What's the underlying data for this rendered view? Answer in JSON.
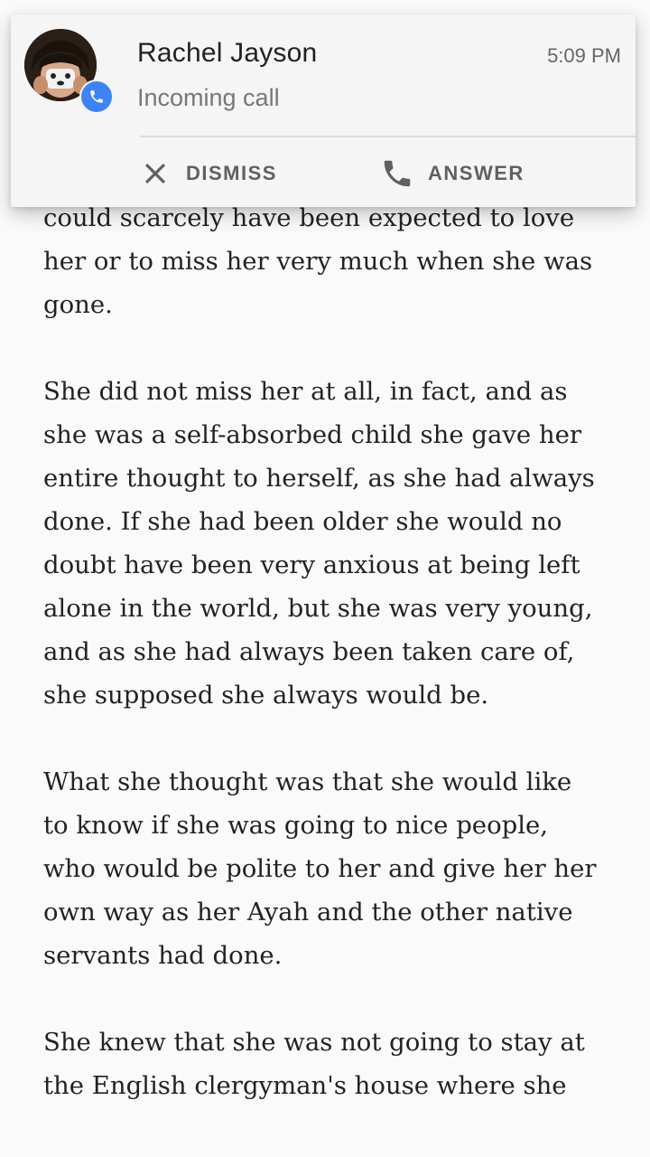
{
  "notification": {
    "caller_name": "Rachel Jayson",
    "status": "Incoming call",
    "time": "5:09 PM",
    "badge_icon": "phone-icon",
    "badge_color": "#3d83f5",
    "actions": [
      {
        "label": "DISMISS",
        "icon": "close-icon"
      },
      {
        "label": "ANSWER",
        "icon": "phone-icon"
      }
    ]
  },
  "reader": {
    "paragraphs": [
      "could scarcely have been expected to love\nher or to miss her very much when she was\ngone.",
      "She did not miss her at all, in fact, and as\nshe was a self-absorbed child she gave her\nentire thought to herself, as she had always\ndone. If she had been older she would no\ndoubt have been very anxious at being left\nalone in the world, but she was very young,\nand as she had always been taken care of,\nshe supposed she always would be.",
      "What she thought was that she would like\nto know if she was going to nice people,\nwho would be polite to her and give her her\nown way as her Ayah and the other native\nservants had done.",
      "She knew that she was not going to stay at\nthe English clergyman's house where she"
    ]
  }
}
